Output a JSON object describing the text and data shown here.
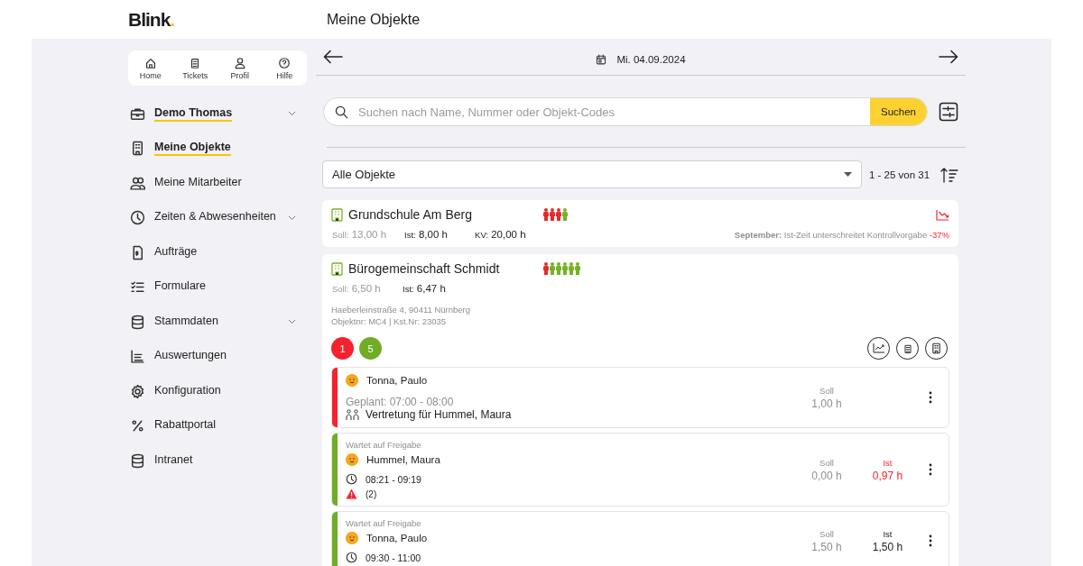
{
  "header": {
    "logo": "Blink.",
    "title": "Meine Objekte"
  },
  "quick_nav": [
    {
      "label": "Home"
    },
    {
      "label": "Tickets"
    },
    {
      "label": "Profil"
    },
    {
      "label": "Hilfe"
    }
  ],
  "sidebar": {
    "items": [
      {
        "label": "Demo Thomas",
        "selected": true,
        "expandable": true
      },
      {
        "label": "Meine Objekte",
        "selected": true,
        "expandable": false
      },
      {
        "label": "Meine Mitarbeiter",
        "selected": false,
        "expandable": false
      },
      {
        "label": "Zeiten & Abwesenheiten",
        "selected": false,
        "expandable": true
      },
      {
        "label": "Aufträge",
        "selected": false,
        "expandable": false
      },
      {
        "label": "Formulare",
        "selected": false,
        "expandable": false
      },
      {
        "label": "Stammdaten",
        "selected": false,
        "expandable": true
      },
      {
        "label": "Auswertungen",
        "selected": false,
        "expandable": false
      },
      {
        "label": "Konfiguration",
        "selected": false,
        "expandable": false
      },
      {
        "label": "Rabattportal",
        "selected": false,
        "expandable": false
      },
      {
        "label": "Intranet",
        "selected": false,
        "expandable": false
      }
    ]
  },
  "date_bar": {
    "date": "Mi. 04.09.2024"
  },
  "search": {
    "placeholder": "Suchen nach Name, Nummer oder Objekt-Codes",
    "button": "Suchen"
  },
  "filter": {
    "value": "Alle Objekte",
    "range": "1 - 25 von 31"
  },
  "objects": [
    {
      "name": "Grundschule Am Berg",
      "staff": [
        {
          "color": "#e52b2b"
        },
        {
          "color": "#e52b2b"
        },
        {
          "color": "#e52b2b"
        },
        {
          "color": "#76b126"
        }
      ],
      "soll_label": "Soll:",
      "soll": "13,00 h",
      "ist_label": "Ist:",
      "ist": "8,00 h",
      "kv_label": "KV:",
      "kv": "20,00 h",
      "trend_down": true,
      "notice": "**September:** Ist-Zeit unterschreitet Kontrollvorgabe",
      "notice_value": "-37%",
      "expanded": false
    },
    {
      "name": "Bürogemeinschaft Schmidt",
      "staff": [
        {
          "color": "#e52b2b"
        },
        {
          "color": "#76b126"
        },
        {
          "color": "#76b126"
        },
        {
          "color": "#76b126"
        },
        {
          "color": "#76b126"
        },
        {
          "color": "#76b126"
        }
      ],
      "soll_label": "Soll:",
      "soll": "6,50 h",
      "ist_label": "Ist:",
      "ist": "6,47 h",
      "trend_down": false,
      "expanded": true,
      "address": "Haeberleinstraße 4, 90411 Nürnberg",
      "codes": "Objektnr: MC4 | Kst.Nr: 23035",
      "counts": [
        {
          "label": "1",
          "color": "#f5222d"
        },
        {
          "label": "5",
          "color": "#70ad25"
        }
      ],
      "assignments": [
        {
          "color": "#f5222d",
          "name": "Tonna, Paulo",
          "planned": "Geplant: 07:00 - 08:00",
          "note": "Vertretung für Hummel, Maura",
          "soll_label": "Soll",
          "soll": "1,00 h"
        },
        {
          "color": "#70ad25",
          "status": "Wartet auf Freigabe",
          "name": "Hummel, Maura",
          "time": "08:21 - 09:19",
          "warning": "(2)",
          "soll_label": "Soll",
          "soll": "0,00 h",
          "ist_label": "Ist",
          "ist": "0,97 h",
          "ist_alert": true
        },
        {
          "color": "#70ad25",
          "status": "Wartet auf Freigabe",
          "name": "Tonna, Paulo",
          "time": "09:30 - 11:00",
          "soll_label": "Soll",
          "soll": "1,50 h",
          "ist_label": "Ist",
          "ist": "1,50 h",
          "ist_alert": false
        }
      ]
    }
  ]
}
